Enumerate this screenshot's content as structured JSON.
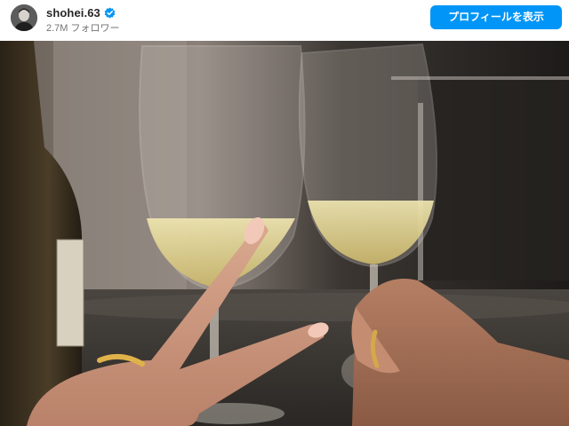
{
  "post_header": {
    "username": "shohei.63",
    "verified_icon": "verified-badge-icon",
    "followers_text": "2.7M フォロワー",
    "view_profile_label": "プロフィールを表示"
  },
  "colors": {
    "accent": "#0095f6",
    "username": "#262626",
    "secondary_text": "#737373"
  },
  "photo": {
    "icon": "post-photo"
  }
}
